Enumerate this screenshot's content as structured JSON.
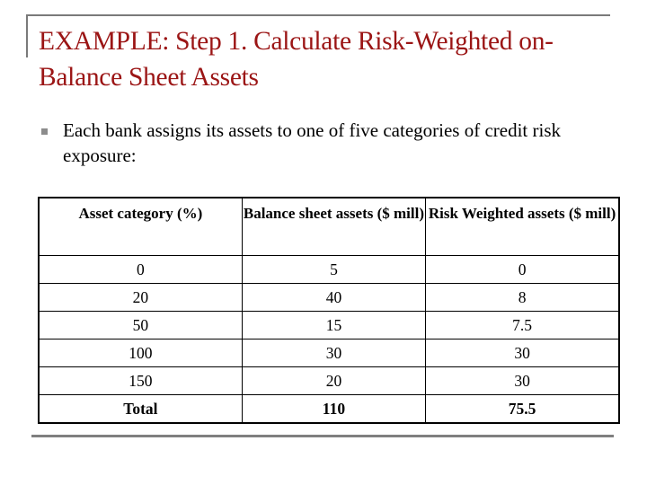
{
  "slide": {
    "title": "EXAMPLE: Step 1. Calculate Risk-Weighted on-Balance Sheet Assets",
    "bullet": {
      "icon": "square-bullet-icon",
      "text": "Each bank assigns its assets to one of five categories of credit risk exposure:"
    },
    "table": {
      "headers": [
        "Asset category (%)",
        "Balance sheet assets ($ mill)",
        "Risk Weighted assets ($ mill)"
      ],
      "rows": [
        [
          "0",
          "5",
          "0"
        ],
        [
          "20",
          "40",
          "8"
        ],
        [
          "50",
          "15",
          "7.5"
        ],
        [
          "100",
          "30",
          "30"
        ],
        [
          "150",
          "20",
          "30"
        ]
      ],
      "total": [
        "Total",
        "110",
        "75.5"
      ]
    },
    "colors": {
      "title": "#9b1515",
      "frame": "#7a7a7a",
      "bullet": "#8c8c8c"
    }
  }
}
